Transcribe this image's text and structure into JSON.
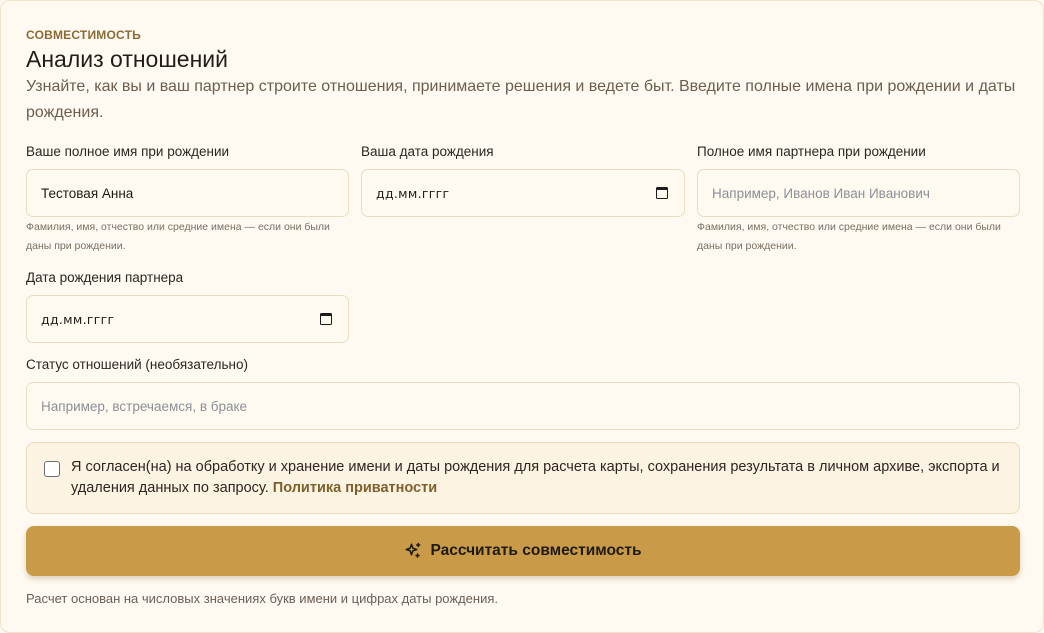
{
  "header": {
    "eyebrow": "СОВМЕСТИМОСТЬ",
    "title": "Анализ отношений",
    "subtitle": "Узнайте, как вы и ваш партнер строите отношения, принимаете решения и ведете быт. Введите полные имена при рождении и даты рождения."
  },
  "form": {
    "your_name": {
      "label": "Ваше полное имя при рождении",
      "value": "Тестовая Анна",
      "hint": "Фамилия, имя, отчество или средние имена — если они были даны при рождении."
    },
    "your_birthdate": {
      "label": "Ваша дата рождения",
      "value": "дд.мм.гггг"
    },
    "partner_name": {
      "label": "Полное имя партнера при рождении",
      "placeholder": "Например, Иванов Иван Иванович",
      "hint": "Фамилия, имя, отчество или средние имена — если они были даны при рождении."
    },
    "partner_birthdate": {
      "label": "Дата рождения партнера",
      "value": "дд.мм.гггг"
    },
    "relationship_status": {
      "label": "Статус отношений (необязательно)",
      "placeholder": "Например, встречаемся, в браке"
    }
  },
  "consent": {
    "checked": false,
    "text": "Я согласен(на) на обработку и хранение имени и даты рождения для расчета карты, сохранения результата в личном архиве, экспорта и удаления данных по запросу.",
    "link": "Политика приватности"
  },
  "submit": {
    "label": "Рассчитать совместимость",
    "icon": "sparkles-icon"
  },
  "footnote": "Расчет основан на числовых значениях букв имени и цифрах даты рождения.",
  "colors": {
    "accent": "#c99a48",
    "background": "#fffaf1",
    "link": "#7f5f2c"
  }
}
